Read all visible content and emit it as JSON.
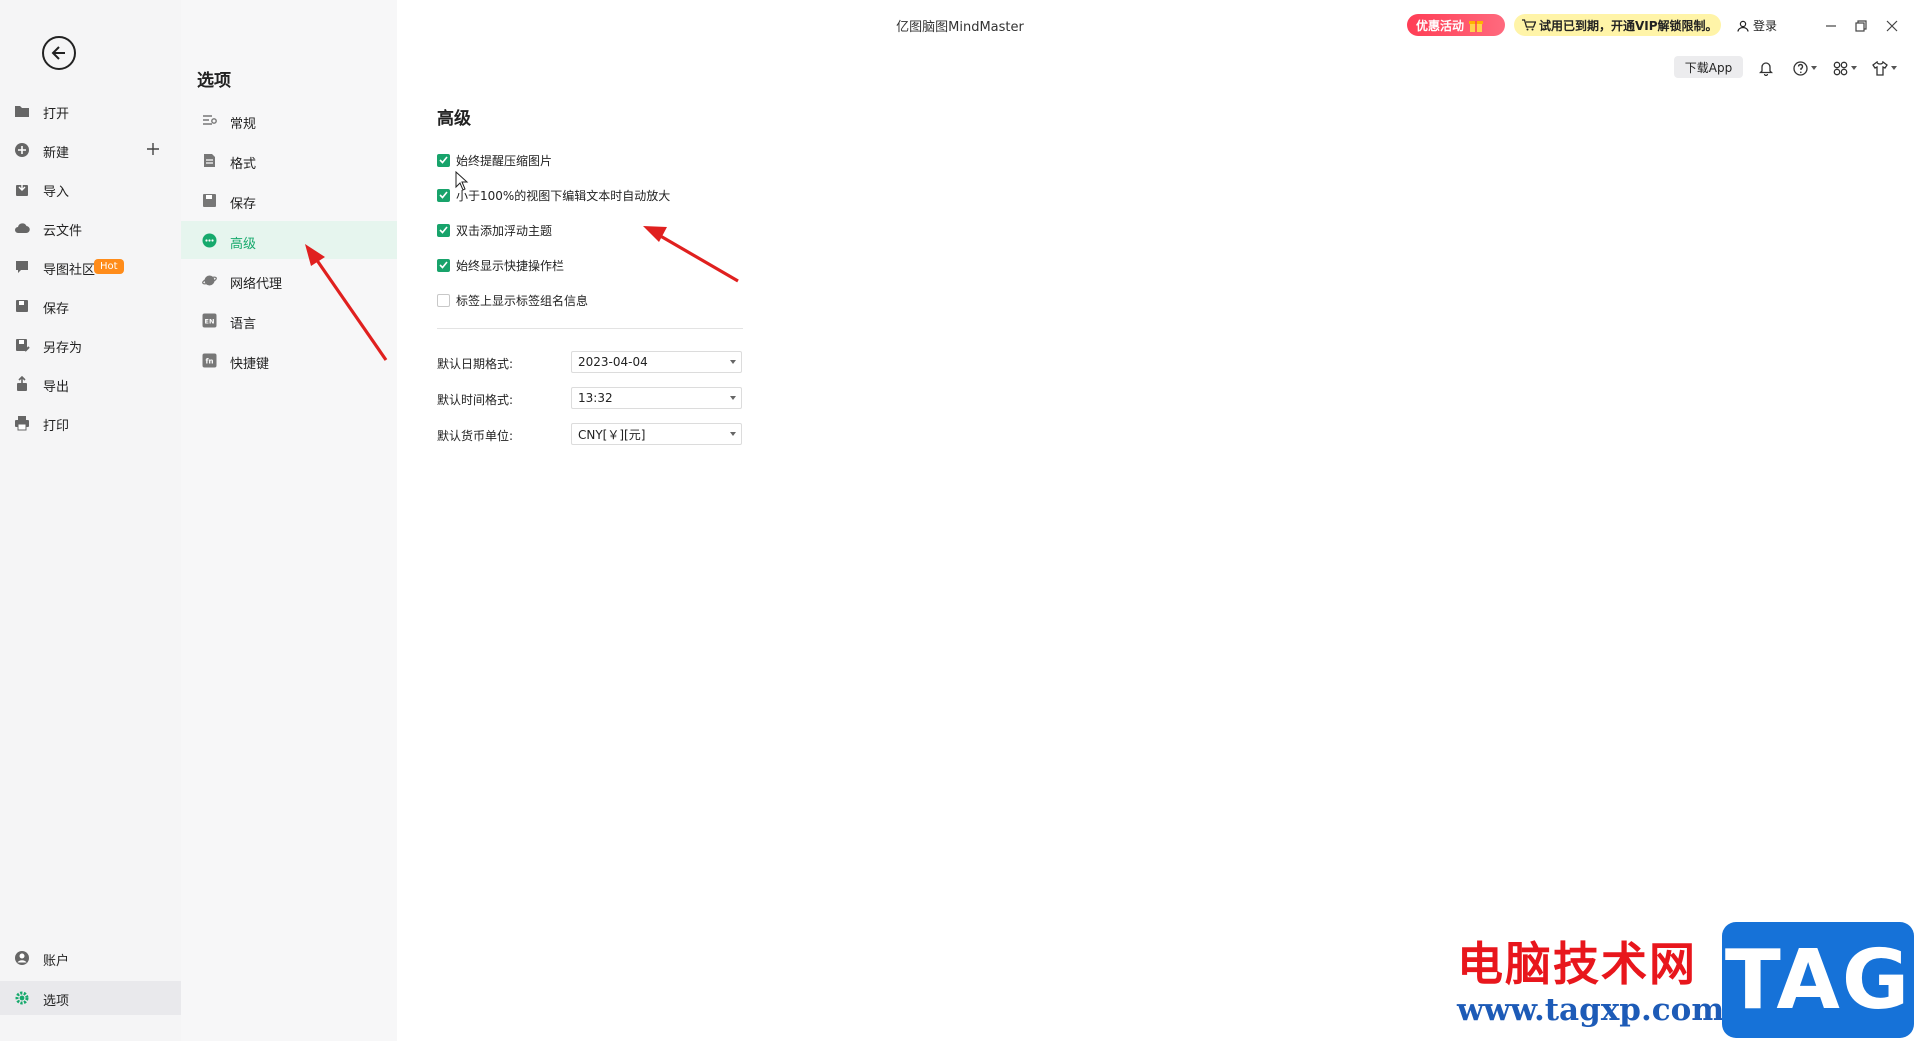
{
  "app": {
    "title": "亿图脑图MindMaster"
  },
  "header": {
    "promo_label": "优惠活动",
    "vip_notice": "试用已到期，开通VIP解锁限制。",
    "login_label": "登录",
    "download_app_label": "下载App"
  },
  "left_rail": {
    "items": [
      {
        "label": "打开",
        "icon": "folder-icon"
      },
      {
        "label": "新建",
        "icon": "plus-circle-icon"
      },
      {
        "label": "导入",
        "icon": "import-icon"
      },
      {
        "label": "云文件",
        "icon": "cloud-icon"
      },
      {
        "label": "导图社区",
        "icon": "community-icon",
        "badge": "Hot"
      },
      {
        "label": "保存",
        "icon": "save-icon"
      },
      {
        "label": "另存为",
        "icon": "save-as-icon"
      },
      {
        "label": "导出",
        "icon": "export-icon"
      },
      {
        "label": "打印",
        "icon": "printer-icon"
      }
    ],
    "bottom_items": [
      {
        "label": "账户",
        "icon": "account-icon"
      },
      {
        "label": "选项",
        "icon": "gear-icon"
      }
    ]
  },
  "options": {
    "title": "选项",
    "items": [
      {
        "label": "常规",
        "icon": "general-icon"
      },
      {
        "label": "格式",
        "icon": "format-icon"
      },
      {
        "label": "保存",
        "icon": "save-icon"
      },
      {
        "label": "高级",
        "icon": "advanced-icon"
      },
      {
        "label": "网络代理",
        "icon": "network-proxy-icon"
      },
      {
        "label": "语言",
        "icon": "language-icon"
      },
      {
        "label": "快捷键",
        "icon": "shortcut-icon"
      }
    ],
    "active_index": 3
  },
  "advanced": {
    "title": "高级",
    "checkboxes": [
      {
        "label": "始终提醒压缩图片",
        "checked": true
      },
      {
        "label": "小于100%的视图下编辑文本时自动放大",
        "checked": true
      },
      {
        "label": "双击添加浮动主题",
        "checked": true
      },
      {
        "label": "始终显示快捷操作栏",
        "checked": true
      },
      {
        "label": "标签上显示标签组名信息",
        "checked": false
      }
    ],
    "fields": [
      {
        "label": "默认日期格式:",
        "value": "2023-04-04"
      },
      {
        "label": "默认时间格式:",
        "value": "13:32"
      },
      {
        "label": "默认货币单位:",
        "value": "CNY[￥][元]"
      }
    ]
  },
  "watermark": {
    "site_name": "电脑技术网",
    "url": "www.tagxp.com",
    "tag": "TAG"
  },
  "colors": {
    "accent": "#16a96c",
    "annotation_arrow": "#e0201f",
    "promo": "#ff3d55",
    "vip_banner": "#fff4a8"
  }
}
